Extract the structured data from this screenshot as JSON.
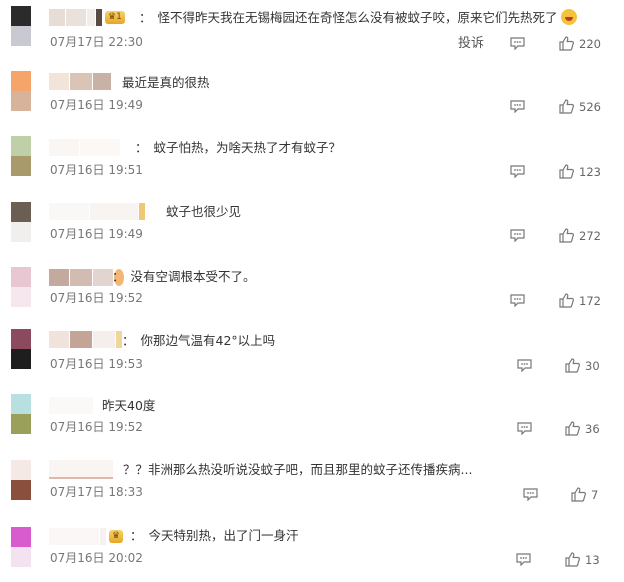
{
  "report_label": "投诉",
  "comments": [
    {
      "text": "怪不得昨天我在无锡梅园还在奇怪怎么没有被蚊子咬，原来它们先热死了",
      "time": "07月17日 22:30",
      "likes": "220",
      "prefix": "："
    },
    {
      "text": "最近是真的很热",
      "time": "07月16日 19:49",
      "likes": "526",
      "prefix": ""
    },
    {
      "text": "蚊子怕热，为啥天热了才有蚊子？",
      "time": "07月16日 19:51",
      "likes": "123",
      "prefix": "："
    },
    {
      "text": "蚊子也很少见",
      "time": "07月16日 19:49",
      "likes": "272",
      "prefix": ""
    },
    {
      "text": "没有空调根本受不了。",
      "time": "07月16日 19:52",
      "likes": "172",
      "prefix": "："
    },
    {
      "text": "你那边气温有42°以上吗",
      "time": "07月16日 19:53",
      "likes": "30",
      "prefix": "："
    },
    {
      "text": "昨天40度",
      "time": "07月16日 19:52",
      "likes": "36",
      "prefix": ""
    },
    {
      "text": "？？非洲那么热没听说没蚊子吧，而且那里的蚊子还传播疾病...",
      "time": "07月17日 18:33",
      "likes": "7",
      "prefix": ""
    },
    {
      "text": "今天特别热，出了门一身汗",
      "time": "07月16日 20:02",
      "likes": "13",
      "prefix": "："
    }
  ],
  "colors": {
    "text": "#333333",
    "meta": "#777777",
    "icon": "#777777"
  },
  "icons": {
    "reply": "comment-icon",
    "like": "thumbs-up-icon",
    "emoji": "laughing-emoji"
  }
}
